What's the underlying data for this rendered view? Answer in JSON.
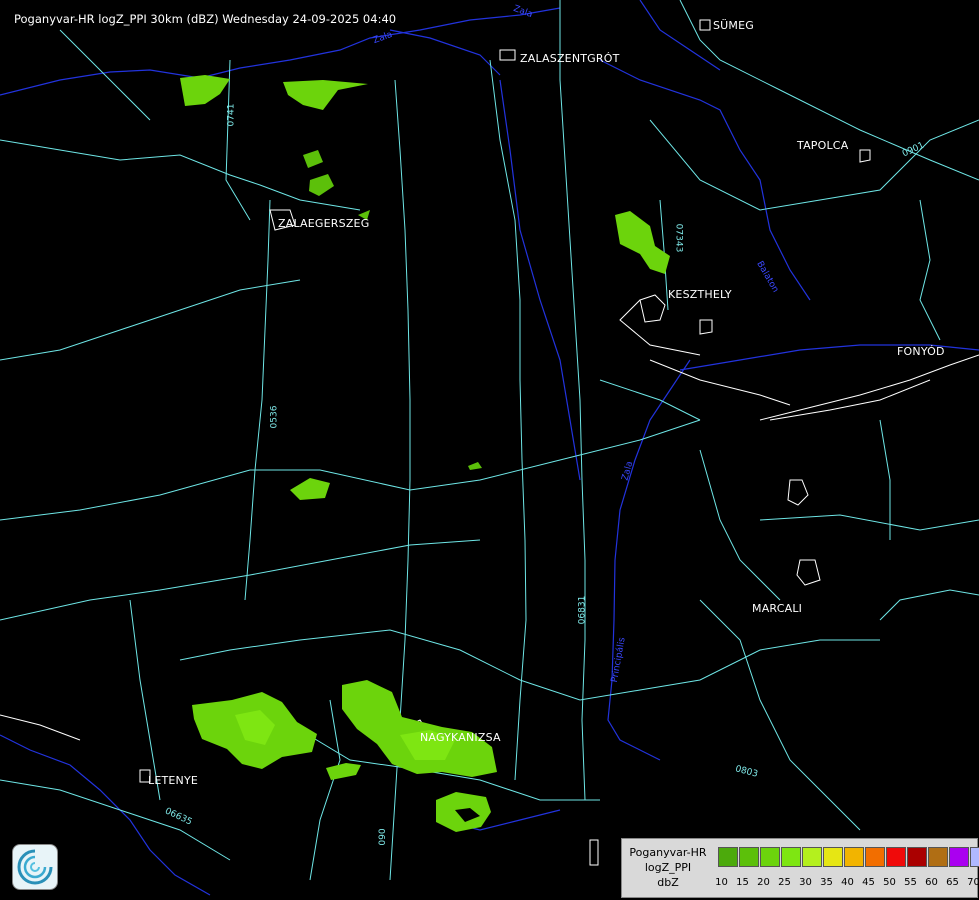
{
  "title": "Poganyvar-HR logZ_PPI 30km (dBZ) Wednesday 24-09-2025 04:40",
  "towns": [
    {
      "id": "sumeg",
      "name": "SÜMEG"
    },
    {
      "id": "zalaszentgrot",
      "name": "ZALASZENTGRÓT"
    },
    {
      "id": "tapolca",
      "name": "TAPOLCA"
    },
    {
      "id": "zalaegerszeg",
      "name": "ZALAEGERSZEG"
    },
    {
      "id": "keszthely",
      "name": "KESZTHELY"
    },
    {
      "id": "fonyod",
      "name": "FONYÓD"
    },
    {
      "id": "marcali",
      "name": "MARCALI"
    },
    {
      "id": "nagykanizsa",
      "name": "NAGYKANIZSA"
    },
    {
      "id": "letenye",
      "name": "LETENYE"
    }
  ],
  "road_labels": [
    "0741",
    "07343",
    "0901",
    "0536",
    "06831",
    "0803",
    "06635",
    "060"
  ],
  "river_labels": [
    "Zala",
    "Zala",
    "Balaton",
    "Zala",
    "Principális"
  ],
  "legend": {
    "name": "Poganyvar-HR",
    "product": "logZ_PPI",
    "unit": "dbZ",
    "scale": [
      {
        "value": "10",
        "color": "#4caa0c"
      },
      {
        "value": "15",
        "color": "#5cc00a"
      },
      {
        "value": "20",
        "color": "#6cd40c"
      },
      {
        "value": "25",
        "color": "#7ee612"
      },
      {
        "value": "30",
        "color": "#b4f01e"
      },
      {
        "value": "35",
        "color": "#e6e614"
      },
      {
        "value": "40",
        "color": "#f2b400"
      },
      {
        "value": "45",
        "color": "#f26e00"
      },
      {
        "value": "50",
        "color": "#f00a0a"
      },
      {
        "value": "55",
        "color": "#aa0000"
      },
      {
        "value": "60",
        "color": "#b06e14"
      },
      {
        "value": "65",
        "color": "#aa00f0"
      },
      {
        "value": "70",
        "color": "#b0b8ff"
      }
    ]
  }
}
